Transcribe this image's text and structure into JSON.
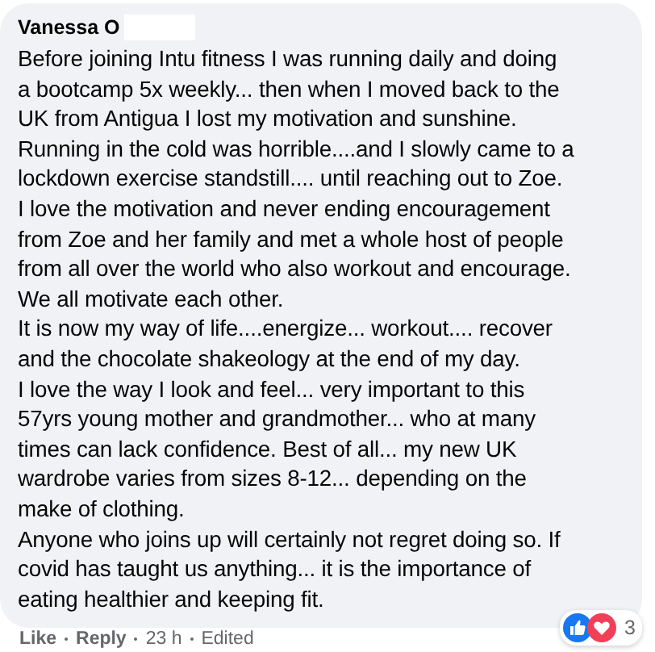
{
  "comment": {
    "author": "Vanessa O",
    "lines": [
      "Before joining Intu fitness I was running daily and doing",
      "a bootcamp 5x weekly... then when I moved back to the",
      "UK from Antigua I lost my motivation and sunshine.",
      "Running in the cold was horrible....and I slowly came to a",
      "lockdown exercise standstill.... until reaching out to Zoe.",
      "I love the motivation and never ending encouragement",
      "from Zoe and her family and met a whole host of people",
      "from all over the world who also workout and encourage.",
      "We all motivate each other.",
      "It is now my way of life....energize... workout.... recover",
      "and the chocolate shakeology at the end of my day.",
      "I love the way I look and feel... very important to this",
      "57yrs young mother and grandmother... who at many",
      "times can lack confidence. Best of all... my new UK",
      "wardrobe varies from sizes 8-12... depending on the",
      "make of clothing.",
      "Anyone who joins up will certainly not regret doing so. If",
      "covid has taught us anything... it is the importance of",
      "eating healthier and keeping fit."
    ],
    "reactions": {
      "icons": [
        {
          "kind": "like"
        },
        {
          "kind": "love"
        }
      ],
      "count": "3"
    },
    "actions": [
      {
        "kind": "link",
        "label": "Like"
      },
      {
        "kind": "link",
        "label": "Reply"
      },
      {
        "kind": "meta",
        "label": "23 h"
      },
      {
        "kind": "meta",
        "label": "Edited"
      }
    ]
  }
}
